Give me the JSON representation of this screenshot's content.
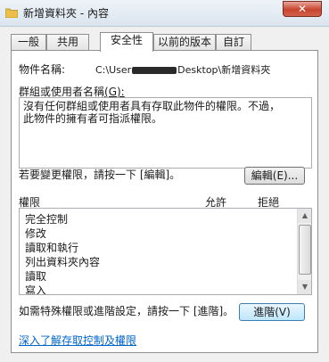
{
  "window": {
    "title": "新增資料夾 - 內容",
    "close_label": "✕"
  },
  "tabs": [
    {
      "label": "一般"
    },
    {
      "label": "共用"
    },
    {
      "label": "安全性",
      "active": true
    },
    {
      "label": "以前的版本"
    },
    {
      "label": "自訂"
    }
  ],
  "security": {
    "object_name_label": "物件名稱:",
    "object_path_prefix": "C:\\User",
    "object_path_suffix": "Desktop\\新增資料夾",
    "groups_label": "群組或使用者名稱",
    "groups_label_accel": "(G):",
    "no_access_line1": "沒有任何群組或使用者具有存取此物件的權限。不過，",
    "no_access_line2": "此物件的擁有者可指派權限。",
    "edit_hint": "若要變更權限，請按一下 [編輯]。",
    "edit_button": "編輯(E)...",
    "permissions_header": "權限",
    "allow_header": "允許",
    "deny_header": "拒絕",
    "permissions": [
      "完全控制",
      "修改",
      "讀取和執行",
      "列出資料夾內容",
      "讀取",
      "寫入"
    ],
    "advanced_hint": "如需特殊權限或進階設定，請按一下 [進階]。",
    "advanced_button": "進階(V)",
    "learn_link": "深入了解存取控制及權限"
  }
}
